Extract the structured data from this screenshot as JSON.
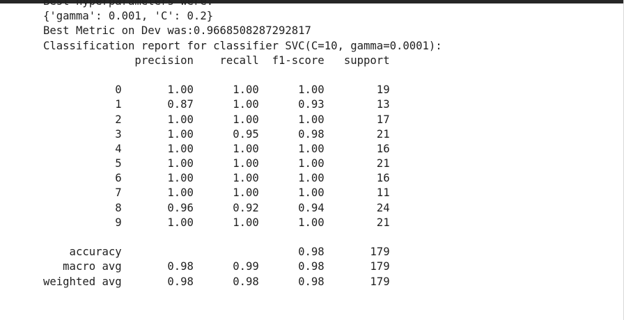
{
  "output": {
    "lines": [
      "Best hyperparameters were:",
      "{'gamma': 0.001, 'C': 0.2}",
      "Best Metric on Dev was:0.9668508287292817",
      "Classification report for classifier SVC(C=10, gamma=0.0001):",
      "              precision    recall  f1-score   support",
      "",
      "           0       1.00      1.00      1.00        19",
      "           1       0.87      1.00      0.93        13",
      "           2       1.00      1.00      1.00        17",
      "           3       1.00      0.95      0.98        21",
      "           4       1.00      1.00      1.00        16",
      "           5       1.00      1.00      1.00        21",
      "           6       1.00      1.00      1.00        16",
      "           7       1.00      1.00      1.00        11",
      "           8       0.96      0.92      0.94        24",
      "           9       1.00      1.00      1.00        21",
      "",
      "    accuracy                           0.98       179",
      "   macro avg       0.98      0.99      0.98       179",
      "weighted avg       0.98      0.98      0.98       179"
    ]
  }
}
